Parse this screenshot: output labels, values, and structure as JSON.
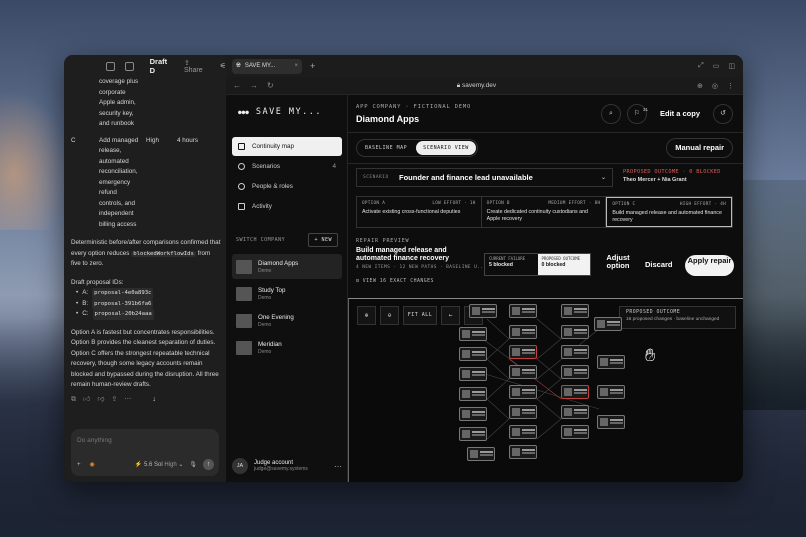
{
  "chat": {
    "title": "Draft D",
    "share_label": "Share",
    "rows": [
      {
        "c1": "",
        "c2": "coverage plus",
        "c3": "",
        "c4": ""
      },
      {
        "c1": "",
        "c2": "corporate",
        "c3": "",
        "c4": ""
      },
      {
        "c1": "",
        "c2": "Apple admin,",
        "c3": "",
        "c4": ""
      },
      {
        "c1": "",
        "c2": "security key,",
        "c3": "",
        "c4": ""
      },
      {
        "c1": "",
        "c2": "and runbook",
        "c3": "",
        "c4": ""
      }
    ],
    "row_c": {
      "c1": "C",
      "c2": "Add managed",
      "c3": "High",
      "c4": "4 hours"
    },
    "row_c_more": [
      "release,",
      "automated",
      "reconciliation,",
      "emergency",
      "refund",
      "controls, and",
      "independent",
      "billing access"
    ],
    "para1_a": "Deterministic before/after comparisons confirmed that every option reduces",
    "para1_code": "blockedWorkflowIds",
    "para1_b": "from five to zero.",
    "ids_heading": "Draft proposal IDs:",
    "ids": [
      {
        "label": "A:",
        "value": "proposal-4e0a893c"
      },
      {
        "label": "B:",
        "value": "proposal-391b6fa6"
      },
      {
        "label": "C:",
        "value": "proposal-20b24aaa"
      }
    ],
    "para2": "Option A is fastest but concentrates responsibilities. Option B provides the cleanest separation of duties. Option C offers the strongest repeatable technical recovery, though some legacy accounts remain blocked and bypassed during the disruption. All three remain human-review drafts.",
    "composer_placeholder": "Do anything",
    "model_label": "5.6 Sol",
    "effort_label": "High"
  },
  "browser": {
    "tab_title": "SAVE MY...",
    "url": "savemy.dev"
  },
  "app": {
    "brand": "SAVE MY...",
    "nav": [
      {
        "label": "Continuity map",
        "count": ""
      },
      {
        "label": "Scenarios",
        "count": "4"
      },
      {
        "label": "People & roles",
        "count": ""
      },
      {
        "label": "Activity",
        "count": ""
      }
    ],
    "switch_label": "SWITCH COMPANY",
    "new_label": "+ NEW",
    "companies": [
      {
        "name": "Diamond Apps",
        "sub": "Demo"
      },
      {
        "name": "Study Top",
        "sub": "Demo"
      },
      {
        "name": "One Evening",
        "sub": "Demo"
      },
      {
        "name": "Meridian",
        "sub": "Demo"
      }
    ],
    "account": {
      "initials": "JA",
      "name": "Judge account",
      "email": "judge@savemy.systems"
    },
    "kicker": "APP COMPANY · FICTIONAL DEMO",
    "title": "Diamond Apps",
    "notif_count": "31",
    "edit_label": "Edit a copy",
    "tab_baseline": "BASELINE MAP",
    "tab_scenario": "SCENARIO VIEW",
    "manual_repair": "Manual repair",
    "scenario_label": "SCENARIO",
    "scenario_value": "Founder and finance lead unavailable",
    "outcome_title": "PROPOSED OUTCOME · 0 BLOCKED",
    "outcome_people": "Theo Mercer + Nia Grant",
    "options": [
      {
        "name": "OPTION A",
        "effort": "LOW EFFORT · 1H",
        "desc": "Activate existing cross-functional deputies"
      },
      {
        "name": "OPTION B",
        "effort": "MEDIUM EFFORT · 8H",
        "desc": "Create dedicated continuity custodians and Apple recovery"
      },
      {
        "name": "OPTION C",
        "effort": "HIGH EFFORT · 4H",
        "desc": "Build managed release and automated finance recovery"
      }
    ],
    "repair_kicker": "REPAIR PREVIEW",
    "repair_title": "Build managed release and automated finance recovery",
    "repair_sub": "4 NEW ITEMS · 12 NEW PATHS · BASELINE U...",
    "current_label": "CURRENT FAILURE",
    "current_value": "5 blocked",
    "proposed_label": "PROPOSED OUTCOME",
    "proposed_value": "0 blocked",
    "adjust_label": "Adjust option",
    "discard_label": "Discard",
    "apply_label": "Apply repair",
    "view_changes": "VIEW 16 EXACT CHANGES",
    "fit_all": "FIT ALL",
    "canvas_outcome_title": "PROPOSED OUTCOME",
    "canvas_outcome_sub": "16 proposed changes · baseline unchanged"
  }
}
